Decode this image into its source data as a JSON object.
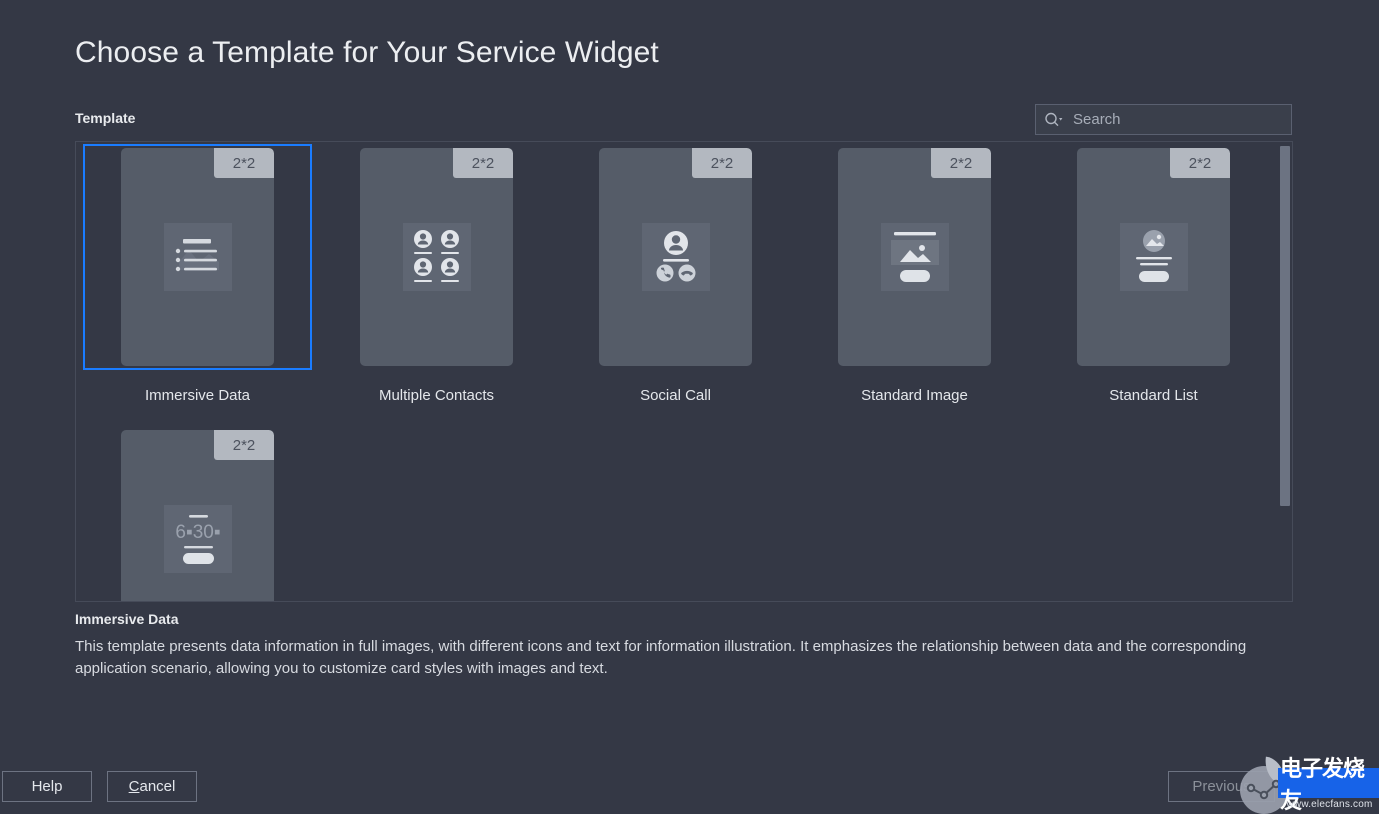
{
  "header": {
    "title": "Choose a Template for Your Service Widget"
  },
  "template_section": {
    "label": "Template"
  },
  "search": {
    "placeholder": "Search",
    "value": "",
    "icon": "search-dropdown-icon"
  },
  "templates": [
    {
      "name": "Immersive Data",
      "size": "2*2",
      "icon": "list-with-image-icon",
      "selected": true
    },
    {
      "name": "Multiple Contacts",
      "size": "2*2",
      "icon": "four-avatars-icon",
      "selected": false
    },
    {
      "name": "Social Call",
      "size": "2*2",
      "icon": "avatar-call-icon",
      "selected": false
    },
    {
      "name": "Standard Image",
      "size": "2*2",
      "icon": "image-card-icon",
      "selected": false
    },
    {
      "name": "Standard List",
      "size": "2*2",
      "icon": "circle-image-list-icon",
      "selected": false
    },
    {
      "name": "",
      "size": "2*2",
      "icon": "time-number-icon",
      "selected": false
    }
  ],
  "description": {
    "title": "Immersive Data",
    "body": "This template presents data information in full images, with different icons and text for information illustration. It emphasizes the relationship between data and the corresponding application scenario, allowing you to customize card styles with images and text."
  },
  "footer": {
    "help_label": "Help",
    "cancel_label": "Cancel",
    "cancel_mnemonic": "C",
    "cancel_rest": "ancel",
    "previous_label": "Previous"
  },
  "watermark": {
    "brand_cn": "电子发烧友",
    "url": "www.elecfans.com"
  },
  "colors": {
    "background": "#343845",
    "thumbnail": "#555c68",
    "selection": "#1a7cff",
    "badge": "#b3b8c0",
    "watermark_blue": "#1763e8"
  }
}
